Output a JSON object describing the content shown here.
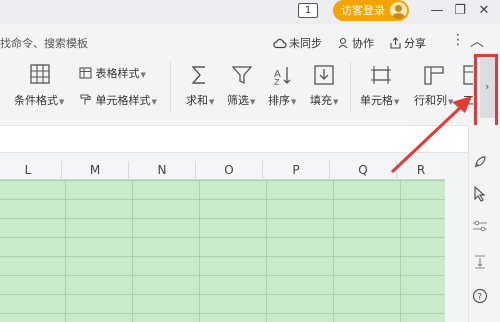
{
  "titlebar": {
    "page_badge": "1",
    "visitor_label": "访客登录",
    "minimize": "—",
    "restore": "❐",
    "close": "✕"
  },
  "cmdbar": {
    "search_hint": "找命令、搜索模板",
    "sync": "未同步",
    "collab": "协作",
    "share": "分享"
  },
  "ribbon": {
    "cond_format": "条件格式",
    "table_style": "表格样式",
    "cell_style": "单元格样式",
    "sum": "求和",
    "filter": "筛选",
    "sort": "排序",
    "fill": "填充",
    "cell": "单元格",
    "rowcol": "行和列",
    "cut_label": "工"
  },
  "columns": [
    "L",
    "M",
    "N",
    "O",
    "P",
    "Q",
    "R"
  ],
  "colors": {
    "accent": "#f5a300",
    "grid_fill": "#c8ebc9",
    "highlight": "#e53935"
  }
}
